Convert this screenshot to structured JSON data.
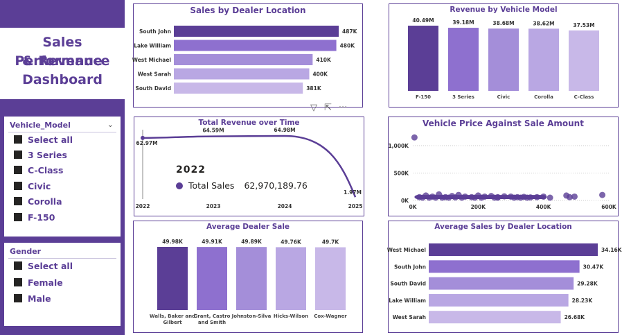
{
  "dashboard_title_lines": [
    "Sales Performance",
    "& Revenue",
    "Dashboard"
  ],
  "colors": {
    "primary": "#5b3e96",
    "shades": [
      "#5b3e96",
      "#8e70cf",
      "#a48ed9",
      "#b9a7e3",
      "#c8b8e8"
    ],
    "background": "#ffffff"
  },
  "vehicle_slicer": {
    "header": "Vehicle_Model",
    "options": [
      "Select all",
      "3 Series",
      "C-Class",
      "Civic",
      "Corolla",
      "F-150"
    ]
  },
  "gender_slicer": {
    "header": "Gender",
    "options": [
      "Select all",
      "Female",
      "Male"
    ]
  },
  "visual_toolbar": {
    "icons": [
      "filter-icon",
      "focus-mode-icon",
      "more-options-icon"
    ]
  },
  "kpi_tooltip": {
    "year": "2022",
    "series_label": "Total Sales",
    "value": "62,970,189.76"
  },
  "chart_data": [
    {
      "id": "sales_by_dealer_location",
      "type": "bar",
      "orientation": "horizontal",
      "title": "Sales by Dealer Location",
      "categories": [
        "South John",
        "Lake William",
        "West Michael",
        "West Sarah",
        "South David"
      ],
      "values": [
        487000,
        480000,
        410000,
        400000,
        381000
      ],
      "labels": [
        "487K",
        "480K",
        "410K",
        "400K",
        "381K"
      ]
    },
    {
      "id": "revenue_by_vehicle_model",
      "type": "bar",
      "title": "Revenue by Vehicle Model",
      "categories": [
        "F-150",
        "3 Series",
        "Civic",
        "Corolla",
        "C-Class"
      ],
      "values": [
        40.49,
        39.18,
        38.68,
        38.62,
        37.53
      ],
      "labels": [
        "40.49M",
        "39.18M",
        "38.68M",
        "38.62M",
        "37.53M"
      ]
    },
    {
      "id": "total_revenue_over_time",
      "type": "line",
      "title": "Total Revenue over Time",
      "x": [
        "2022",
        "2023",
        "2024",
        "2025"
      ],
      "values": [
        62.97,
        64.59,
        64.98,
        1.97
      ],
      "labels": [
        "62.97M",
        "64.59M",
        "64.98M",
        "1.97M"
      ],
      "ylim": [
        0,
        70
      ]
    },
    {
      "id": "vehicle_price_vs_sale_amount",
      "type": "scatter",
      "title": "Vehicle Price Against Sale Amount",
      "xlim": [
        0,
        600000
      ],
      "ylim": [
        0,
        1000000
      ],
      "x_ticks": [
        "0K",
        "200K",
        "400K",
        "600K"
      ],
      "y_ticks": [
        "0K",
        "500K",
        "1,000K"
      ],
      "grid": true,
      "points": [
        [
          5000,
          1150000
        ],
        [
          20000,
          60000
        ],
        [
          40000,
          90000
        ],
        [
          60000,
          70000
        ],
        [
          80000,
          110000
        ],
        [
          100000,
          60000
        ],
        [
          120000,
          80000
        ],
        [
          140000,
          100000
        ],
        [
          160000,
          70000
        ],
        [
          180000,
          60000
        ],
        [
          200000,
          90000
        ],
        [
          220000,
          70000
        ],
        [
          240000,
          80000
        ],
        [
          260000,
          60000
        ],
        [
          280000,
          75000
        ],
        [
          300000,
          70000
        ],
        [
          320000,
          60000
        ],
        [
          340000,
          65000
        ],
        [
          360000,
          55000
        ],
        [
          380000,
          60000
        ],
        [
          400000,
          70000
        ],
        [
          420000,
          50000
        ],
        [
          470000,
          90000
        ],
        [
          480000,
          60000
        ],
        [
          495000,
          70000
        ],
        [
          580000,
          100000
        ],
        [
          50000,
          30000
        ],
        [
          90000,
          40000
        ],
        [
          150000,
          35000
        ],
        [
          210000,
          25000
        ],
        [
          260000,
          30000
        ],
        [
          310000,
          35000
        ],
        [
          350000,
          20000
        ],
        [
          110000,
          20000
        ],
        [
          30000,
          15000
        ],
        [
          70000,
          50000
        ],
        [
          130000,
          55000
        ],
        [
          190000,
          45000
        ],
        [
          250000,
          40000
        ],
        [
          330000,
          40000
        ]
      ]
    },
    {
      "id": "average_dealer_sale",
      "type": "bar",
      "title": "Average Dealer Sale",
      "categories": [
        [
          "Walls, Baker and",
          "Gilbert"
        ],
        [
          "Grant, Castro",
          "and Smith"
        ],
        [
          "Johnston-Silva"
        ],
        [
          "Hicks-Wilson"
        ],
        [
          "Cox-Wagner"
        ]
      ],
      "values": [
        49.98,
        49.91,
        49.89,
        49.76,
        49.7
      ],
      "labels": [
        "49.98K",
        "49.91K",
        "49.89K",
        "49.76K",
        "49.7K"
      ]
    },
    {
      "id": "average_sales_by_dealer_location",
      "type": "bar",
      "orientation": "horizontal",
      "title": "Average Sales by Dealer Location",
      "categories": [
        "West Michael",
        "South John",
        "South David",
        "Lake William",
        "West Sarah"
      ],
      "values": [
        34.16,
        30.47,
        29.28,
        28.23,
        26.68
      ],
      "labels": [
        "34.16K",
        "30.47K",
        "29.28K",
        "28.23K",
        "26.68K"
      ]
    }
  ]
}
